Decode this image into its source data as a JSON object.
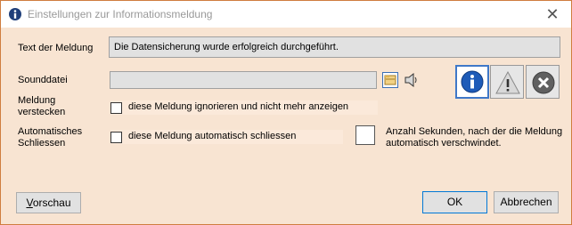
{
  "window": {
    "title": "Einstellungen zur Informationsmeldung",
    "close_glyph": "✕"
  },
  "message": {
    "label": "Text der Meldung",
    "value": "Die Datensicherung wurde erfolgreich durchgeführt."
  },
  "sound": {
    "label": "Sounddatei",
    "value": ""
  },
  "hide": {
    "label_line1": "Meldung",
    "label_line2": "verstecken",
    "checkbox_label": "diese Meldung ignorieren und nicht mehr anzeigen",
    "checked": false
  },
  "autoclose": {
    "label_line1": "Automatisches",
    "label_line2": "Schliessen",
    "checkbox_label": "diese Meldung automatisch schliessen",
    "checked": false,
    "seconds": "",
    "hint_line1": "Anzahl Sekunden, nach der die Meldung",
    "hint_line2": "automatisch verschwindet."
  },
  "icon_options": [
    "info-icon",
    "warning-icon",
    "error-icon"
  ],
  "selected_icon": "info-icon",
  "buttons": {
    "preview_underline": "V",
    "preview_rest": "orschau",
    "ok": "OK",
    "cancel": "Abbrechen"
  },
  "colors": {
    "background": "#f8e4d2",
    "border": "#cf7d3f",
    "selected": "#3f78c8",
    "info_blue": "#1e5bb8",
    "error_gray": "#606060"
  }
}
